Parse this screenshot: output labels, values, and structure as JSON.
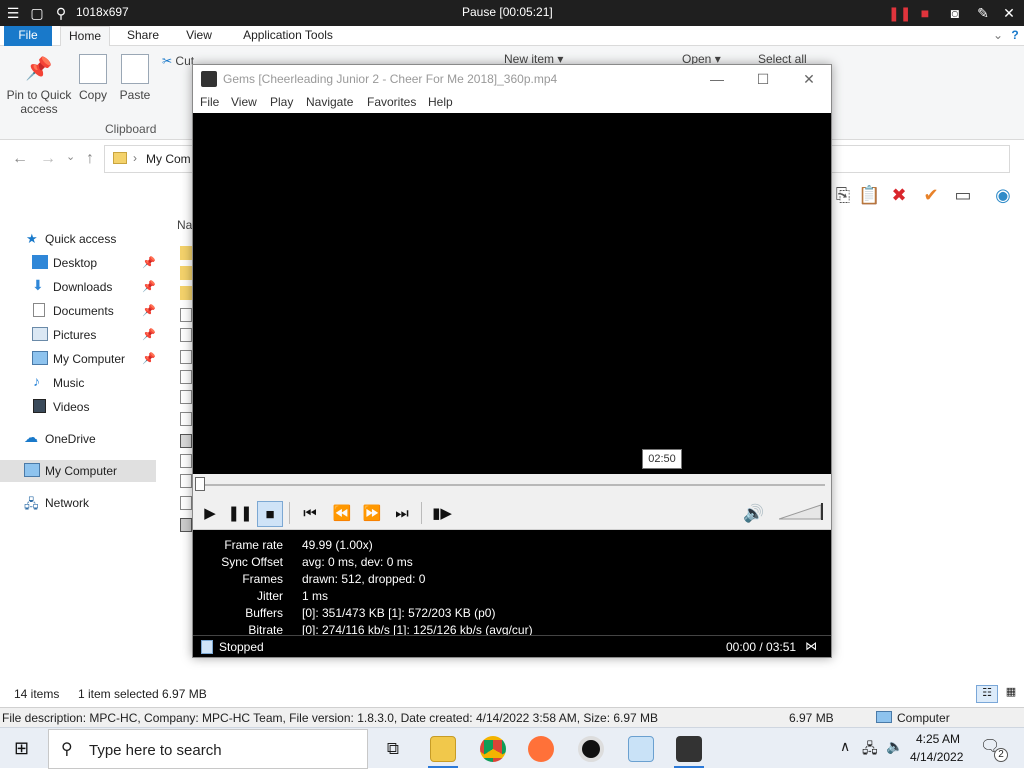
{
  "topbar": {
    "resolution": "1018x697",
    "session_status": "Pause [00:05:21]"
  },
  "ribbon": {
    "tabs": [
      "File",
      "Home",
      "Share",
      "View",
      "Application Tools"
    ],
    "pin_label": "Pin to Quick access",
    "copy_label": "Copy",
    "paste_label": "Paste",
    "cut_label": "Cut",
    "clipboard_group": "Clipboard",
    "new_item_label": "New item",
    "open_label": "Open",
    "select_all_label": "Select all"
  },
  "address": {
    "path": "My Com"
  },
  "nav": {
    "quick_access": "Quick access",
    "items": [
      "Desktop",
      "Downloads",
      "Documents",
      "Pictures",
      "My Computer",
      "Music",
      "Videos"
    ],
    "onedrive": "OneDrive",
    "my_computer": "My Computer",
    "network": "Network"
  },
  "filelist": {
    "name_header": "Na"
  },
  "explorer_status": {
    "item_count": "14 items",
    "selection": "1 item selected  6.97 MB",
    "description": "File description: MPC-HC, Company: MPC-HC Team, File version: 1.8.3.0, Date created: 4/14/2022 3:58 AM, Size: 6.97 MB",
    "size": "6.97 MB",
    "location": "Computer"
  },
  "mpc": {
    "title": "Gems  [Cheerleading Junior 2 - Cheer For Me 2018]_360p.mp4",
    "menu": [
      "File",
      "View",
      "Play",
      "Navigate",
      "Favorites",
      "Help"
    ],
    "seek_tooltip": "02:50",
    "seek_position": 0.0,
    "stats": [
      {
        "label": "Frame rate",
        "value": "49.99 (1.00x)"
      },
      {
        "label": "Sync Offset",
        "value": "avg: 0 ms, dev: 0 ms"
      },
      {
        "label": "Frames",
        "value": "drawn: 512, dropped: 0"
      },
      {
        "label": "Jitter",
        "value": "1 ms"
      },
      {
        "label": "Buffers",
        "value": "[0]: 351/473 KB [1]: 572/203 KB (p0)"
      },
      {
        "label": "Bitrate",
        "value": "[0]: 274/116 kb/s [1]: 125/126 kb/s (avg/cur)"
      }
    ],
    "status": "Stopped",
    "time": "00:00 / 03:51"
  },
  "taskbar": {
    "search_placeholder": "Type here to search",
    "time": "4:25 AM",
    "date": "4/14/2022",
    "notification_count": "2"
  },
  "colors": {
    "accent": "#1979ca",
    "video_bg": "#000000",
    "stop_highlight": "#cfe3f7",
    "delete_red": "#d9262c",
    "check_orange": "#e8822a"
  }
}
